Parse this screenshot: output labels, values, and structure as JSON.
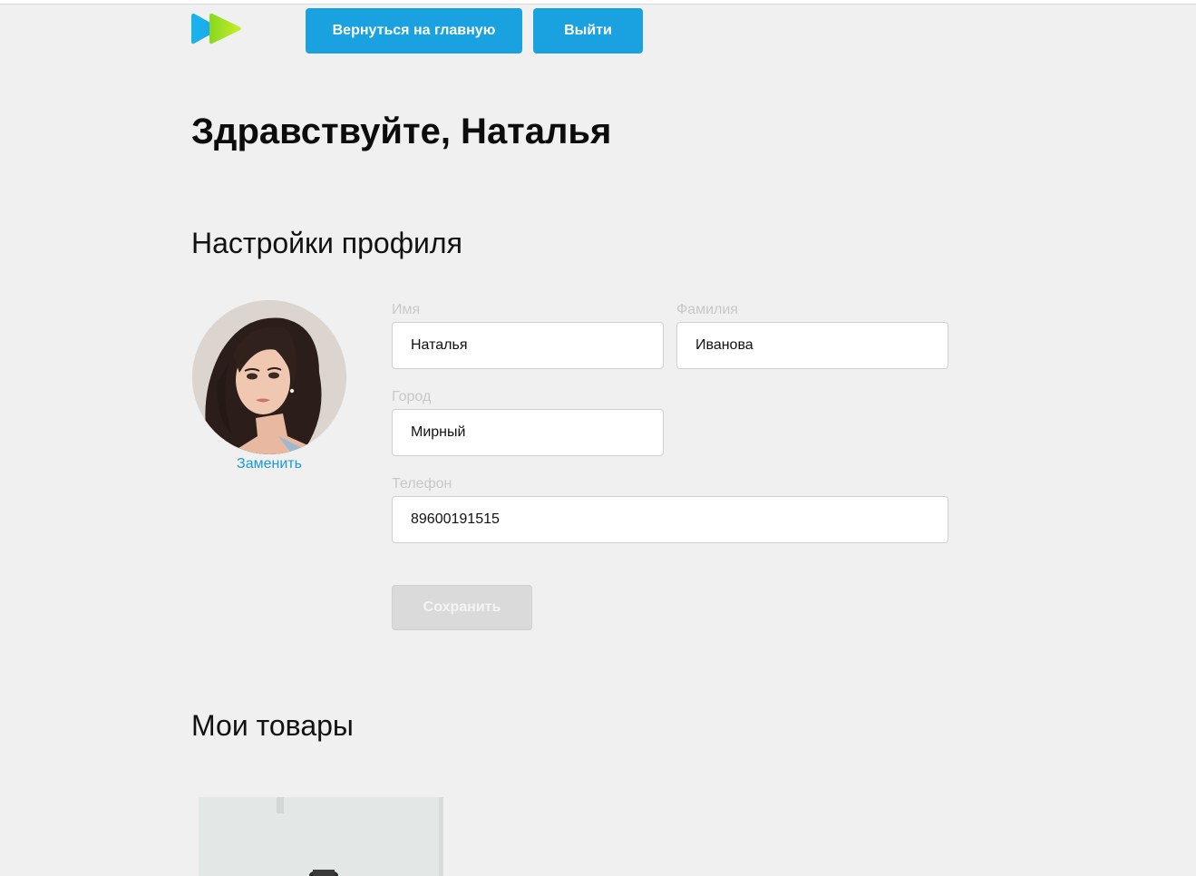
{
  "header": {
    "logo_icon": "play-forward-logo-icon",
    "home_button_label": "Вернуться на главную",
    "logout_button_label": "Выйти"
  },
  "greeting": "Здравствуйте, Наталья",
  "profile": {
    "title": "Настройки профиля",
    "avatar_icon": "user-avatar",
    "replace_label": "Заменить",
    "fields": {
      "name": {
        "label": "Имя",
        "value": "Наталья"
      },
      "surname": {
        "label": "Фамилия",
        "value": "Иванова"
      },
      "city": {
        "label": "Город",
        "value": "Мирный"
      },
      "phone": {
        "label": "Телефон",
        "value": "89600191515"
      }
    },
    "save_label": "Сохранить"
  },
  "goods": {
    "title": "Мои товары"
  },
  "colors": {
    "accent": "#1aa1e0",
    "link": "#1a9bd4",
    "background": "#f0f0f0",
    "disabled_button": "#dadada"
  }
}
